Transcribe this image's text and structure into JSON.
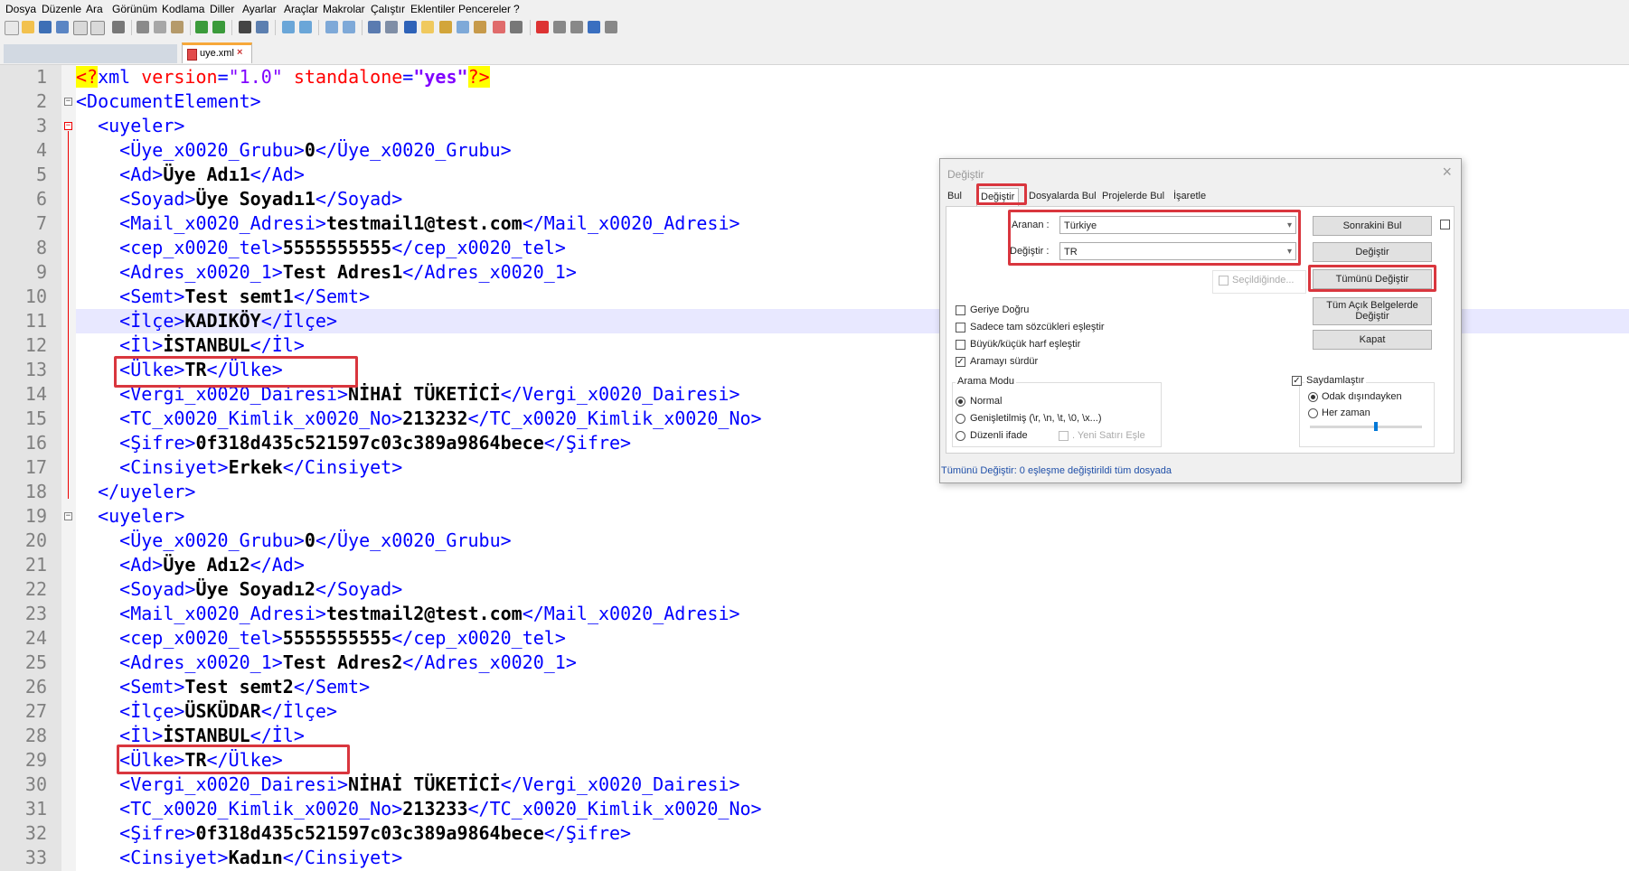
{
  "menu": [
    "Dosya",
    "Düzenle",
    "Ara",
    "Görünüm",
    "Kodlama",
    "Diller",
    "Ayarlar",
    "Araçlar",
    "Makrolar",
    "Çalıştır",
    "Eklentiler",
    "Pencereler",
    "?"
  ],
  "tabs": {
    "active_file": "uye.xml"
  },
  "lines": [
    {
      "n": "1",
      "segs": [
        [
          "pi",
          "<?"
        ],
        [
          "t",
          "xml "
        ],
        [
          "attr",
          "version"
        ],
        [
          "t",
          "="
        ],
        [
          "str",
          "\"1.0\""
        ],
        [
          "t",
          " "
        ],
        [
          "attr",
          "standalone"
        ],
        [
          "t",
          "="
        ],
        [
          "stroff",
          "\"yes\""
        ],
        [
          "pi",
          "?>"
        ]
      ]
    },
    {
      "n": "2",
      "segs": [
        [
          "t",
          "<DocumentElement>"
        ]
      ]
    },
    {
      "n": "3",
      "segs": [
        [
          "t",
          "  <uyeler>"
        ]
      ]
    },
    {
      "n": "4",
      "segs": [
        [
          "t",
          "    <Üye_x0020_Grubu>"
        ],
        [
          "v",
          "0"
        ],
        [
          "t",
          "</Üye_x0020_Grubu>"
        ]
      ]
    },
    {
      "n": "5",
      "segs": [
        [
          "t",
          "    <Ad>"
        ],
        [
          "v",
          "Üye Adı1"
        ],
        [
          "t",
          "</Ad>"
        ]
      ]
    },
    {
      "n": "6",
      "segs": [
        [
          "t",
          "    <Soyad>"
        ],
        [
          "v",
          "Üye Soyadı1"
        ],
        [
          "t",
          "</Soyad>"
        ]
      ]
    },
    {
      "n": "7",
      "segs": [
        [
          "t",
          "    <Mail_x0020_Adresi>"
        ],
        [
          "v",
          "testmail1@test.com"
        ],
        [
          "t",
          "</Mail_x0020_Adresi>"
        ]
      ]
    },
    {
      "n": "8",
      "segs": [
        [
          "t",
          "    <cep_x0020_tel>"
        ],
        [
          "v",
          "5555555555"
        ],
        [
          "t",
          "</cep_x0020_tel>"
        ]
      ]
    },
    {
      "n": "9",
      "segs": [
        [
          "t",
          "    <Adres_x0020_1>"
        ],
        [
          "v",
          "Test Adres1"
        ],
        [
          "t",
          "</Adres_x0020_1>"
        ]
      ]
    },
    {
      "n": "10",
      "segs": [
        [
          "t",
          "    <Semt>"
        ],
        [
          "v",
          "Test semt1"
        ],
        [
          "t",
          "</Semt>"
        ]
      ]
    },
    {
      "n": "11",
      "segs": [
        [
          "t",
          "    <İlçe>"
        ],
        [
          "v",
          "KADIKÖY"
        ],
        [
          "t",
          "</İlçe>"
        ]
      ]
    },
    {
      "n": "12",
      "segs": [
        [
          "t",
          "    <İl>"
        ],
        [
          "v",
          "İSTANBUL"
        ],
        [
          "t",
          "</İl>"
        ]
      ]
    },
    {
      "n": "13",
      "segs": [
        [
          "t",
          "    <Ülke>"
        ],
        [
          "v",
          "TR"
        ],
        [
          "t",
          "</Ülke>"
        ]
      ]
    },
    {
      "n": "14",
      "segs": [
        [
          "t",
          "    <Vergi_x0020_Dairesi>"
        ],
        [
          "v",
          "NİHAİ TÜKETİCİ"
        ],
        [
          "t",
          "</Vergi_x0020_Dairesi>"
        ]
      ]
    },
    {
      "n": "15",
      "segs": [
        [
          "t",
          "    <TC_x0020_Kimlik_x0020_No>"
        ],
        [
          "v",
          "213232"
        ],
        [
          "t",
          "</TC_x0020_Kimlik_x0020_No>"
        ]
      ]
    },
    {
      "n": "16",
      "segs": [
        [
          "t",
          "    <Şifre>"
        ],
        [
          "v",
          "0f318d435c521597c03c389a9864bece"
        ],
        [
          "t",
          "</Şifre>"
        ]
      ]
    },
    {
      "n": "17",
      "segs": [
        [
          "t",
          "    <Cinsiyet>"
        ],
        [
          "v",
          "Erkek"
        ],
        [
          "t",
          "</Cinsiyet>"
        ]
      ]
    },
    {
      "n": "18",
      "segs": [
        [
          "t",
          "  </uyeler>"
        ]
      ]
    },
    {
      "n": "19",
      "segs": [
        [
          "t",
          "  <uyeler>"
        ]
      ]
    },
    {
      "n": "20",
      "segs": [
        [
          "t",
          "    <Üye_x0020_Grubu>"
        ],
        [
          "v",
          "0"
        ],
        [
          "t",
          "</Üye_x0020_Grubu>"
        ]
      ]
    },
    {
      "n": "21",
      "segs": [
        [
          "t",
          "    <Ad>"
        ],
        [
          "v",
          "Üye Adı2"
        ],
        [
          "t",
          "</Ad>"
        ]
      ]
    },
    {
      "n": "22",
      "segs": [
        [
          "t",
          "    <Soyad>"
        ],
        [
          "v",
          "Üye Soyadı2"
        ],
        [
          "t",
          "</Soyad>"
        ]
      ]
    },
    {
      "n": "23",
      "segs": [
        [
          "t",
          "    <Mail_x0020_Adresi>"
        ],
        [
          "v",
          "testmail2@test.com"
        ],
        [
          "t",
          "</Mail_x0020_Adresi>"
        ]
      ]
    },
    {
      "n": "24",
      "segs": [
        [
          "t",
          "    <cep_x0020_tel>"
        ],
        [
          "v",
          "5555555555"
        ],
        [
          "t",
          "</cep_x0020_tel>"
        ]
      ]
    },
    {
      "n": "25",
      "segs": [
        [
          "t",
          "    <Adres_x0020_1>"
        ],
        [
          "v",
          "Test Adres2"
        ],
        [
          "t",
          "</Adres_x0020_1>"
        ]
      ]
    },
    {
      "n": "26",
      "segs": [
        [
          "t",
          "    <Semt>"
        ],
        [
          "v",
          "Test semt2"
        ],
        [
          "t",
          "</Semt>"
        ]
      ]
    },
    {
      "n": "27",
      "segs": [
        [
          "t",
          "    <İlçe>"
        ],
        [
          "v",
          "ÜSKÜDAR"
        ],
        [
          "t",
          "</İlçe>"
        ]
      ]
    },
    {
      "n": "28",
      "segs": [
        [
          "t",
          "    <İl>"
        ],
        [
          "v",
          "İSTANBUL"
        ],
        [
          "t",
          "</İl>"
        ]
      ]
    },
    {
      "n": "29",
      "segs": [
        [
          "t",
          "    <Ülke>"
        ],
        [
          "v",
          "TR"
        ],
        [
          "t",
          "</Ülke>"
        ]
      ]
    },
    {
      "n": "30",
      "segs": [
        [
          "t",
          "    <Vergi_x0020_Dairesi>"
        ],
        [
          "v",
          "NİHAİ TÜKETİCİ"
        ],
        [
          "t",
          "</Vergi_x0020_Dairesi>"
        ]
      ]
    },
    {
      "n": "31",
      "segs": [
        [
          "t",
          "    <TC_x0020_Kimlik_x0020_No>"
        ],
        [
          "v",
          "213233"
        ],
        [
          "t",
          "</TC_x0020_Kimlik_x0020_No>"
        ]
      ]
    },
    {
      "n": "32",
      "segs": [
        [
          "t",
          "    <Şifre>"
        ],
        [
          "v",
          "0f318d435c521597c03c389a9864bece"
        ],
        [
          "t",
          "</Şifre>"
        ]
      ]
    },
    {
      "n": "33",
      "segs": [
        [
          "t",
          "    <Cinsiyet>"
        ],
        [
          "v",
          "Kadın"
        ],
        [
          "t",
          "</Cinsiyet>"
        ]
      ]
    }
  ],
  "dialog": {
    "title": "Değiştir",
    "tabs": [
      "Bul",
      "Değiştir",
      "Dosyalarda Bul",
      "Projelerde Bul",
      "İşaretle"
    ],
    "find_label": "Aranan :",
    "find_value": "Türkiye",
    "replace_label": "Değiştir :",
    "replace_value": "TR",
    "in_selection": "Seçildiğinde...",
    "buttons": {
      "find_next": "Sonrakini Bul",
      "replace": "Değiştir",
      "replace_all": "Tümünü Değiştir",
      "replace_all_open_line1": "Tüm Açık Belgelerde",
      "replace_all_open_line2": "Değiştir",
      "close": "Kapat"
    },
    "options": {
      "backward": "Geriye Doğru",
      "whole_word": "Sadece tam sözcükleri eşleştir",
      "match_case": "Büyük/küçük harf eşleştir",
      "wrap": "Aramayı sürdür"
    },
    "search_mode": {
      "title": "Arama Modu",
      "normal": "Normal",
      "extended": "Genişletilmiş (\\r, \\n, \\t, \\0, \\x...)",
      "regex": "Düzenli ifade",
      "newline": ". Yeni Satırı Eşle"
    },
    "transparency": {
      "title": "Saydamlaştır",
      "on_lose_focus": "Odak dışındayken",
      "always": "Her zaman"
    },
    "status": "Tümünü Değiştir: 0 eşleşme değiştirildi tüm dosyada",
    "close_glyph": "×",
    "check_glyph": "✓",
    "combo_arrow": "▾"
  },
  "fold": {
    "minus": "−"
  },
  "colors": {
    "tag": "#0000ff",
    "value": "#000000",
    "attr": "#ff0000",
    "string": "#8000ff",
    "highlight": "#d9363e"
  }
}
